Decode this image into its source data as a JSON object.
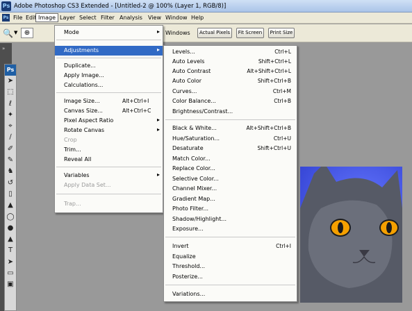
{
  "title_bar": {
    "app_icon": "Ps",
    "title": "Adobe Photoshop CS3 Extended - [Untitled-2 @ 100% (Layer 1, RGB/8)]"
  },
  "menu_bar": {
    "app_icon": "Ps",
    "items": [
      "File",
      "Edit",
      "Image",
      "Layer",
      "Select",
      "Filter",
      "Analysis",
      "View",
      "Window",
      "Help"
    ],
    "active": "Image"
  },
  "options_bar": {
    "zoom_tool_icon": "zoom-tool-icon",
    "windows_label": "Windows",
    "buttons": [
      "Actual Pixels",
      "Fit Screen",
      "Print Size"
    ]
  },
  "toolbox": {
    "logo": "Ps",
    "tools": [
      "move-tool-icon",
      "marquee-tool-icon",
      "lasso-tool-icon",
      "magic-wand-icon",
      "crop-tool-icon",
      "slice-tool-icon",
      "healing-brush-icon",
      "brush-tool-icon",
      "clone-stamp-icon",
      "history-brush-icon",
      "eraser-tool-icon",
      "gradient-tool-icon",
      "blur-tool-icon",
      "dodge-tool-icon",
      "pen-tool-icon",
      "type-tool-icon",
      "path-selection-icon",
      "shape-tool-icon",
      "notes-tool-icon"
    ]
  },
  "image_menu": {
    "items": [
      {
        "label": "Mode",
        "submenu": true
      },
      {
        "label": "Adjustments",
        "submenu": true,
        "highlighted": true
      },
      {
        "label": "Duplicate..."
      },
      {
        "label": "Apply Image..."
      },
      {
        "label": "Calculations..."
      },
      {
        "label": "Image Size...",
        "shortcut": "Alt+Ctrl+I"
      },
      {
        "label": "Canvas Size...",
        "shortcut": "Alt+Ctrl+C"
      },
      {
        "label": "Pixel Aspect Ratio",
        "submenu": true
      },
      {
        "label": "Rotate Canvas",
        "submenu": true
      },
      {
        "label": "Crop",
        "disabled": true
      },
      {
        "label": "Trim..."
      },
      {
        "label": "Reveal All"
      },
      {
        "label": "Variables",
        "submenu": true
      },
      {
        "label": "Apply Data Set...",
        "disabled": true
      },
      {
        "label": "Trap...",
        "disabled": true
      }
    ]
  },
  "adjustments_menu": {
    "items": [
      {
        "label": "Levels...",
        "shortcut": "Ctrl+L"
      },
      {
        "label": "Auto Levels",
        "shortcut": "Shift+Ctrl+L"
      },
      {
        "label": "Auto Contrast",
        "shortcut": "Alt+Shift+Ctrl+L"
      },
      {
        "label": "Auto Color",
        "shortcut": "Shift+Ctrl+B"
      },
      {
        "label": "Curves...",
        "shortcut": "Ctrl+M"
      },
      {
        "label": "Color Balance...",
        "shortcut": "Ctrl+B"
      },
      {
        "label": "Brightness/Contrast..."
      },
      {
        "label": "Black & White...",
        "shortcut": "Alt+Shift+Ctrl+B"
      },
      {
        "label": "Hue/Saturation...",
        "shortcut": "Ctrl+U"
      },
      {
        "label": "Desaturate",
        "shortcut": "Shift+Ctrl+U"
      },
      {
        "label": "Match Color..."
      },
      {
        "label": "Replace Color..."
      },
      {
        "label": "Selective Color..."
      },
      {
        "label": "Channel Mixer..."
      },
      {
        "label": "Gradient Map..."
      },
      {
        "label": "Photo Filter..."
      },
      {
        "label": "Shadow/Highlight..."
      },
      {
        "label": "Exposure..."
      },
      {
        "label": "Invert",
        "shortcut": "Ctrl+I"
      },
      {
        "label": "Equalize"
      },
      {
        "label": "Threshold..."
      },
      {
        "label": "Posterize..."
      },
      {
        "label": "Variations..."
      }
    ]
  },
  "colors": {
    "menu_highlight": "#316ac5",
    "workspace": "#999999",
    "canvas_bg": "#3a4ad9",
    "cat_eye": "#f5a000"
  }
}
